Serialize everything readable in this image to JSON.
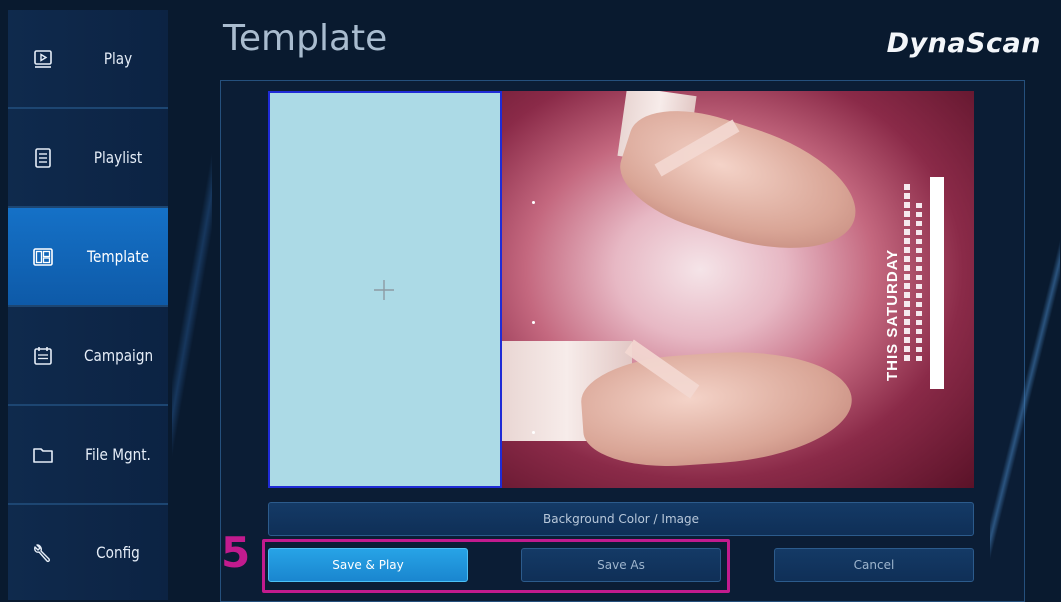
{
  "sidebar": {
    "items": [
      {
        "label": "Play",
        "icon": "play-icon",
        "active": false
      },
      {
        "label": "Playlist",
        "icon": "list-icon",
        "active": false
      },
      {
        "label": "Template",
        "icon": "template-icon",
        "active": true
      },
      {
        "label": "Campaign",
        "icon": "calendar-icon",
        "active": false
      },
      {
        "label": "File Mgnt.",
        "icon": "folder-icon",
        "active": false
      },
      {
        "label": "Config",
        "icon": "wrench-icon",
        "active": false
      }
    ]
  },
  "header": {
    "title": "Template",
    "brand": "DynaScan"
  },
  "canvas": {
    "poster_headline": "THIS SATURDAY"
  },
  "actions": {
    "background_label": "Background Color / Image",
    "save_play_label": "Save & Play",
    "save_as_label": "Save As",
    "cancel_label": "Cancel"
  },
  "annotation": {
    "step_number": "5",
    "color": "#c21b8e"
  },
  "colors": {
    "active_nav": "#1571c7",
    "primary_button": "#1a86cf",
    "zone_fill": "#acdae6",
    "zone_border": "#1f2bd6"
  }
}
